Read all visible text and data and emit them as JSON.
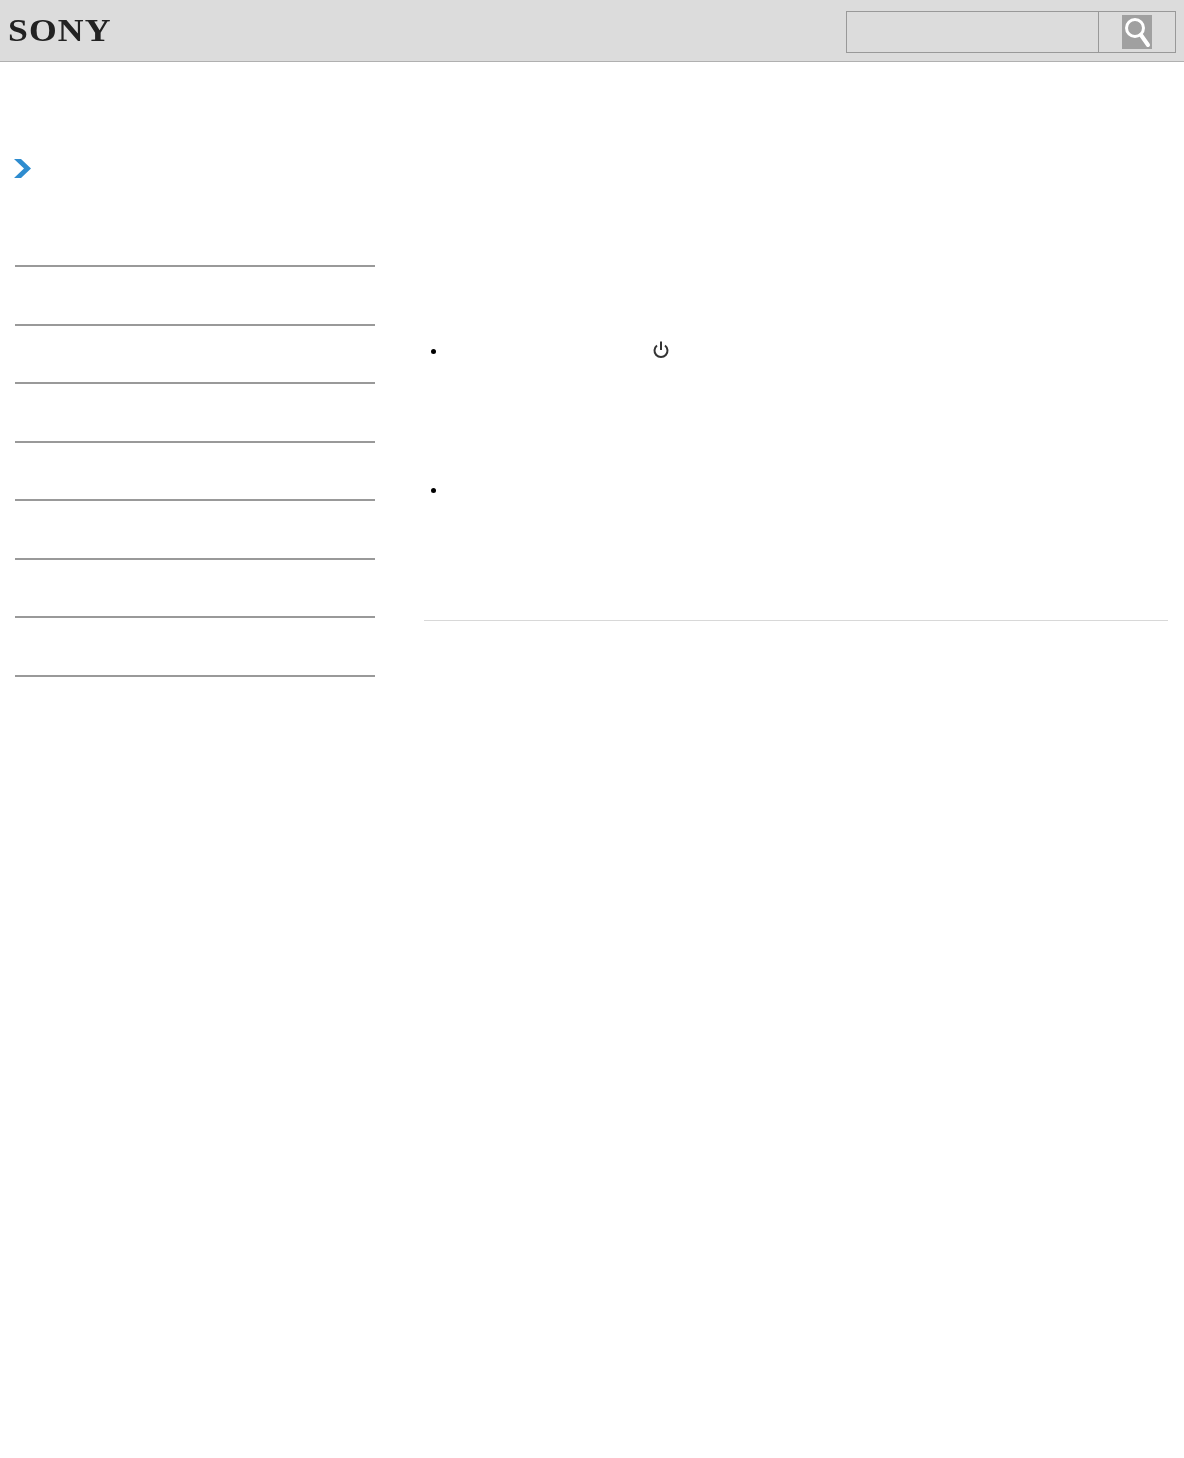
{
  "header": {
    "logo": "SONY"
  },
  "content": {
    "bullets": [
      {
        "kind": "power"
      },
      {
        "kind": "plain"
      }
    ]
  }
}
